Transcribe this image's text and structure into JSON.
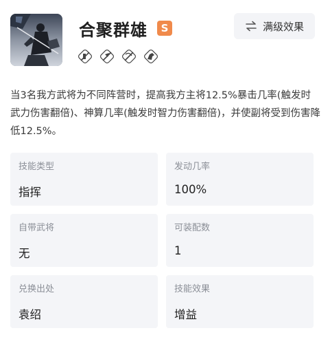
{
  "skill": {
    "title": "合聚群雄",
    "grade": "S",
    "max_effect_label": "满级效果",
    "traits": [
      "slash-icon",
      "spear-icon",
      "bow-icon",
      "horse-icon"
    ],
    "description": "当3名我方武将为不同阵营时，提高我方主将12.5%暴击几率(触发时武力伤害翻倍)、神算几率(触发时智力伤害翻倍)，并使副将受到伤害降低12.5%。"
  },
  "attributes": [
    {
      "label": "技能类型",
      "value": "指挥"
    },
    {
      "label": "发动几率",
      "value": "100%"
    },
    {
      "label": "自带武将",
      "value": "无"
    },
    {
      "label": "可装配数",
      "value": "1"
    },
    {
      "label": "兑换出处",
      "value": "袁绍"
    },
    {
      "label": "技能效果",
      "value": "增益"
    }
  ],
  "colors": {
    "badge": "#f08a4b",
    "card": "#f4f5f8",
    "button": "#f3f4f7"
  }
}
